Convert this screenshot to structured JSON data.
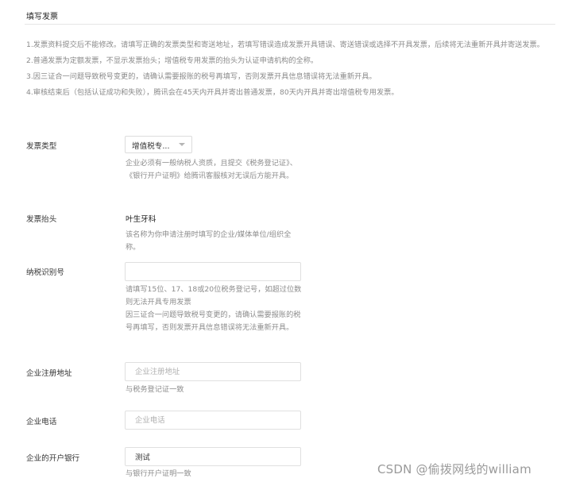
{
  "section_title": "填写发票",
  "notice": [
    "1.发票资料提交后不能修改。请填写正确的发票类型和寄送地址，若填写错误造成发票开具错误、寄送错误或选择不开具发票，后续将无法重新开具并寄送发票。",
    "2.普通发票为定额发票，不显示发票抬头；增值税专用发票的抬头为认证申请机构的全称。",
    "3.因三证合一问题导致税号变更的，请确认需要报账的税号再填写，否则发票开具信息错误将无法重新开具。",
    "4.审核结束后（包括认证成功和失败），腾讯会在45天内开具并寄出普通发票，80天内开具并寄出增值税专用发票。"
  ],
  "invoice_type": {
    "label": "发票类型",
    "selected": "增值税专...",
    "hint": "企业必须有一般纳税人资质，且提交《税务登记证》、《银行开户证明》给腾讯客服核对无误后方能开具。"
  },
  "invoice_title": {
    "label": "发票抬头",
    "value": "叶生牙科",
    "hint": "该名称为你申请注册时填写的企业/媒体单位/组织全称。"
  },
  "tax_id": {
    "label": "纳税识别号",
    "value": "",
    "placeholder": "",
    "hint_line1": "请填写15位、17、18或20位税务登记号，如超过位数则无法开具专用发票",
    "hint_line2": "因三证合一问题导致税号变更的，请确认需要报账的税号再填写，否则发票开具信息错误将无法重新开具。"
  },
  "company_address": {
    "label": "企业注册地址",
    "placeholder": "企业注册地址",
    "hint": "与税务登记证一致"
  },
  "company_phone": {
    "label": "企业电话",
    "placeholder": "企业电话"
  },
  "company_bank": {
    "label": "企业的开户银行",
    "value": "测试",
    "hint": "与银行开户证明一致"
  },
  "watermark": "CSDN @偷拨网线的william"
}
